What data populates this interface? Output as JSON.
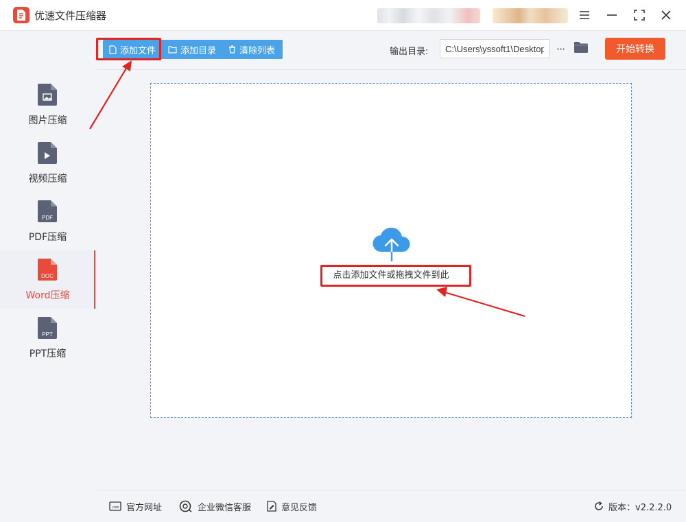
{
  "app": {
    "title": "优速文件压缩器"
  },
  "sidebar": {
    "items": [
      {
        "label": "图片压缩",
        "icon": "image-file-icon",
        "tag": ""
      },
      {
        "label": "视频压缩",
        "icon": "video-file-icon",
        "tag": ""
      },
      {
        "label": "PDF压缩",
        "icon": "pdf-file-icon",
        "tag": "PDF"
      },
      {
        "label": "Word压缩",
        "icon": "doc-file-icon",
        "tag": "DOC",
        "active": true
      },
      {
        "label": "PPT压缩",
        "icon": "ppt-file-icon",
        "tag": "PPT"
      }
    ]
  },
  "toolbar": {
    "add_file": "添加文件",
    "add_folder": "添加目录",
    "clear_list": "清除列表",
    "output_label": "输出目录:",
    "output_path": "C:\\Users\\yssoft1\\Desktop",
    "more": "···",
    "start": "开始转换"
  },
  "main": {
    "drop_hint": "点击添加文件或拖拽文件到此"
  },
  "status": {
    "website": "官方网址",
    "wechat": "企业微信客服",
    "feedback": "意见反馈",
    "version": "版本：v2.2.2.0"
  },
  "colors": {
    "accent": "#e84a3c",
    "toolbar_blue": "#4aa3e8",
    "start_orange": "#f05a2c",
    "annotation_red": "#e02424",
    "icon_gray": "#5b6275"
  }
}
